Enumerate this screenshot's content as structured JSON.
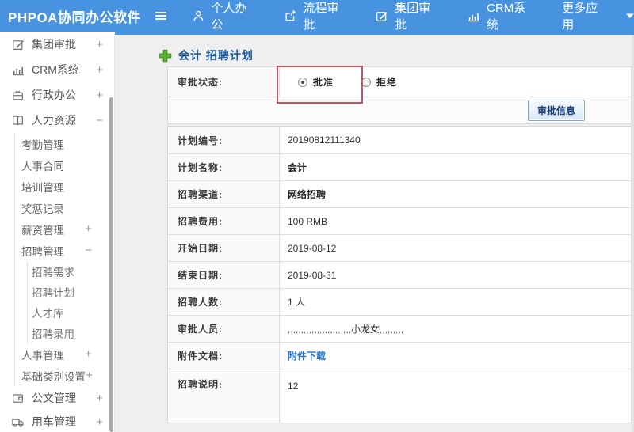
{
  "colors": {
    "header_blue": "#4793df",
    "title_blue": "#1c5a9b",
    "link_blue": "#2373c8",
    "annotation_red": "#c45664",
    "plus_green": "#5cb531"
  },
  "header": {
    "app_title": "PHPOA协同办公软件",
    "nav": [
      {
        "label": "个人办公",
        "icon": "user-icon"
      },
      {
        "label": "流程审批",
        "icon": "process-icon"
      },
      {
        "label": "集团审批",
        "icon": "edit-icon"
      },
      {
        "label": "CRM系统",
        "icon": "bar-chart-icon"
      },
      {
        "label": "更多应用",
        "icon": "caret-down-icon"
      }
    ]
  },
  "sidebar": {
    "items": [
      {
        "label": "集团审批",
        "expand": "+",
        "icon": "edit-square-icon"
      },
      {
        "label": "CRM系统",
        "expand": "+",
        "icon": "bar-chart-icon"
      },
      {
        "label": "行政办公",
        "expand": "+",
        "icon": "briefcase-icon"
      },
      {
        "label": "人力资源",
        "expand": "−",
        "icon": "book-icon"
      },
      {
        "label": "考勤管理"
      },
      {
        "label": "人事合同"
      },
      {
        "label": "培训管理"
      },
      {
        "label": "奖惩记录"
      },
      {
        "label": "薪资管理",
        "expand": "+"
      },
      {
        "label": "招聘管理",
        "expand": "−"
      },
      {
        "label": "招聘需求"
      },
      {
        "label": "招聘计划"
      },
      {
        "label": "人才库"
      },
      {
        "label": "招聘录用"
      },
      {
        "label": "人事管理",
        "expand": "+"
      },
      {
        "label": "基础类别设置",
        "expand": "+"
      },
      {
        "label": "公文管理",
        "expand": "+",
        "icon": "document-icon"
      },
      {
        "label": "用车管理",
        "expand": "+",
        "icon": "truck-icon"
      }
    ]
  },
  "main": {
    "page_title": "会计 招聘计划",
    "approval": {
      "label": "审批状态:",
      "options": [
        {
          "label": "批准",
          "selected": true
        },
        {
          "label": "拒绝",
          "selected": false
        }
      ],
      "info_button": "审批信息"
    },
    "fields": [
      {
        "label": "计划编号:",
        "value": "20190812111340"
      },
      {
        "label": "计划名称:",
        "value": "会计"
      },
      {
        "label": "招聘渠道:",
        "value": "网络招聘"
      },
      {
        "label": "招聘费用:",
        "value": "100 RMB"
      },
      {
        "label": "开始日期:",
        "value": "2019-08-12"
      },
      {
        "label": "结束日期:",
        "value": "2019-08-31"
      },
      {
        "label": "招聘人数:",
        "value": "1 人"
      },
      {
        "label": "审批人员:",
        "value": ",,,,,,,,,,,,,,,,,,,,,,,,小龙女,,,,,,,,,"
      },
      {
        "label": "附件文档:",
        "value": "附件下载",
        "type": "link"
      },
      {
        "label": "招聘说明:",
        "lines": [
          "1",
          "2"
        ]
      }
    ]
  }
}
